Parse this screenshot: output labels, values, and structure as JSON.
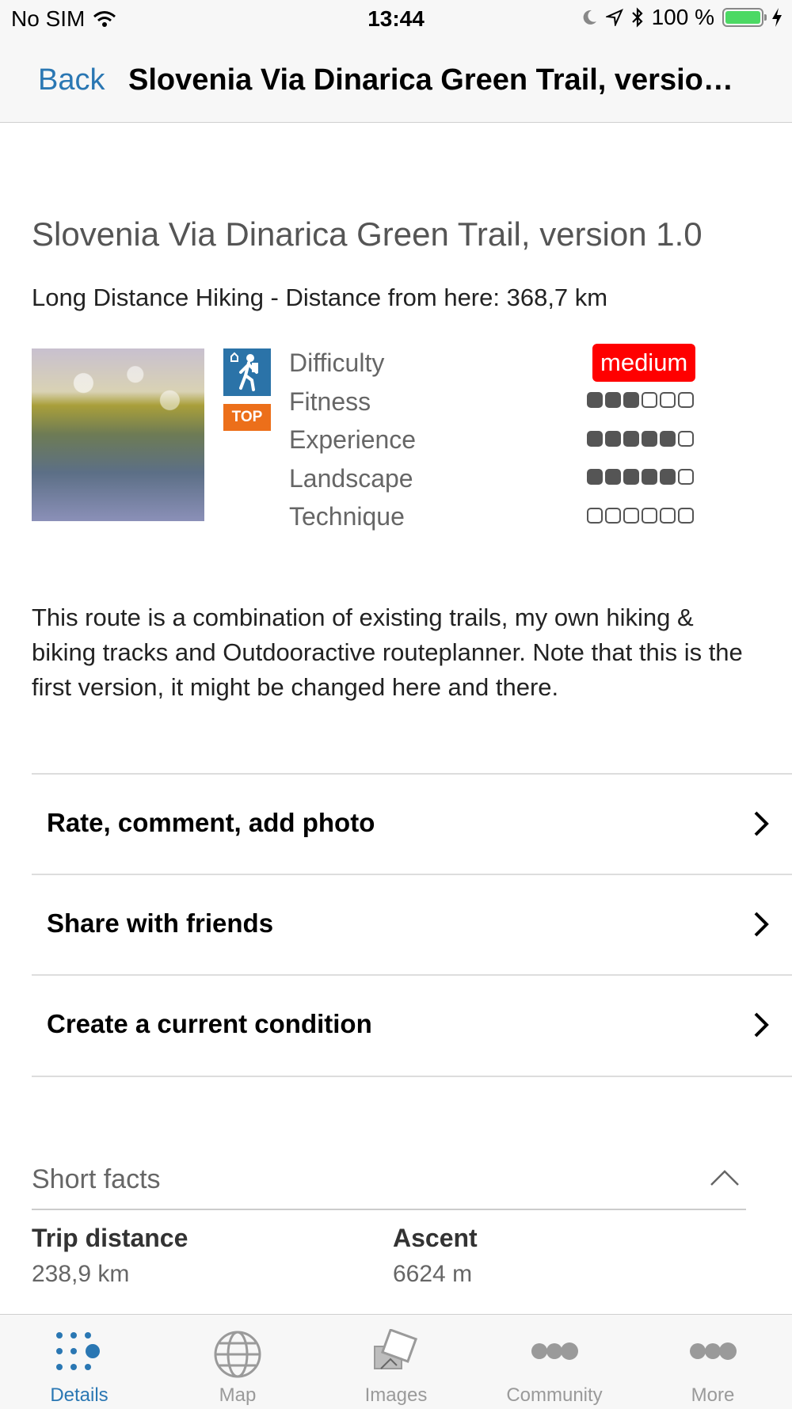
{
  "status_bar": {
    "carrier": "No SIM",
    "time": "13:44",
    "battery": "100 %",
    "battery_level": 1.0,
    "icons": [
      "wifi-icon",
      "moon-icon",
      "location-icon",
      "bluetooth-icon",
      "battery-icon",
      "charging-icon"
    ]
  },
  "nav": {
    "back_label": "Back",
    "title": "Slovenia Via Dinarica Green Trail, versio…"
  },
  "route": {
    "title": "Slovenia Via Dinarica Green Trail, version 1.0",
    "subtitle": "Long Distance Hiking - Distance from here: 368,7 km",
    "top_badge": "TOP",
    "activity_icon": "hiking-icon",
    "ratings": {
      "difficulty_label": "Difficulty",
      "difficulty_value": "medium",
      "difficulty_color": "#ff0000",
      "fitness_label": "Fitness",
      "fitness": 3,
      "experience_label": "Experience",
      "experience": 5,
      "landscape_label": "Landscape",
      "landscape": 5,
      "technique_label": "Technique",
      "technique": 0,
      "max": 6
    },
    "description": "This route is a combination of existing trails, my own hiking & biking tracks and Outdooractive routeplanner. Note that this is the first version, it might be changed here and there."
  },
  "actions": [
    {
      "label": "Rate, comment, add photo"
    },
    {
      "label": "Share with friends"
    },
    {
      "label": "Create a current condition"
    }
  ],
  "short_facts": {
    "title": "Short facts",
    "trip_distance_label": "Trip distance",
    "trip_distance_value": "238,9 km",
    "ascent_label": "Ascent",
    "ascent_value": "6624 m"
  },
  "tabs": [
    {
      "label": "Details",
      "icon": "details-dots-icon",
      "active": true
    },
    {
      "label": "Map",
      "icon": "globe-icon",
      "active": false
    },
    {
      "label": "Images",
      "icon": "images-icon",
      "active": false
    },
    {
      "label": "Community",
      "icon": "community-icon",
      "active": false
    },
    {
      "label": "More",
      "icon": "more-icon",
      "active": false
    }
  ],
  "colors": {
    "accent": "#2a77b3",
    "top_badge": "#ec6f1a",
    "hiking_icon_bg": "#2b73a8"
  }
}
